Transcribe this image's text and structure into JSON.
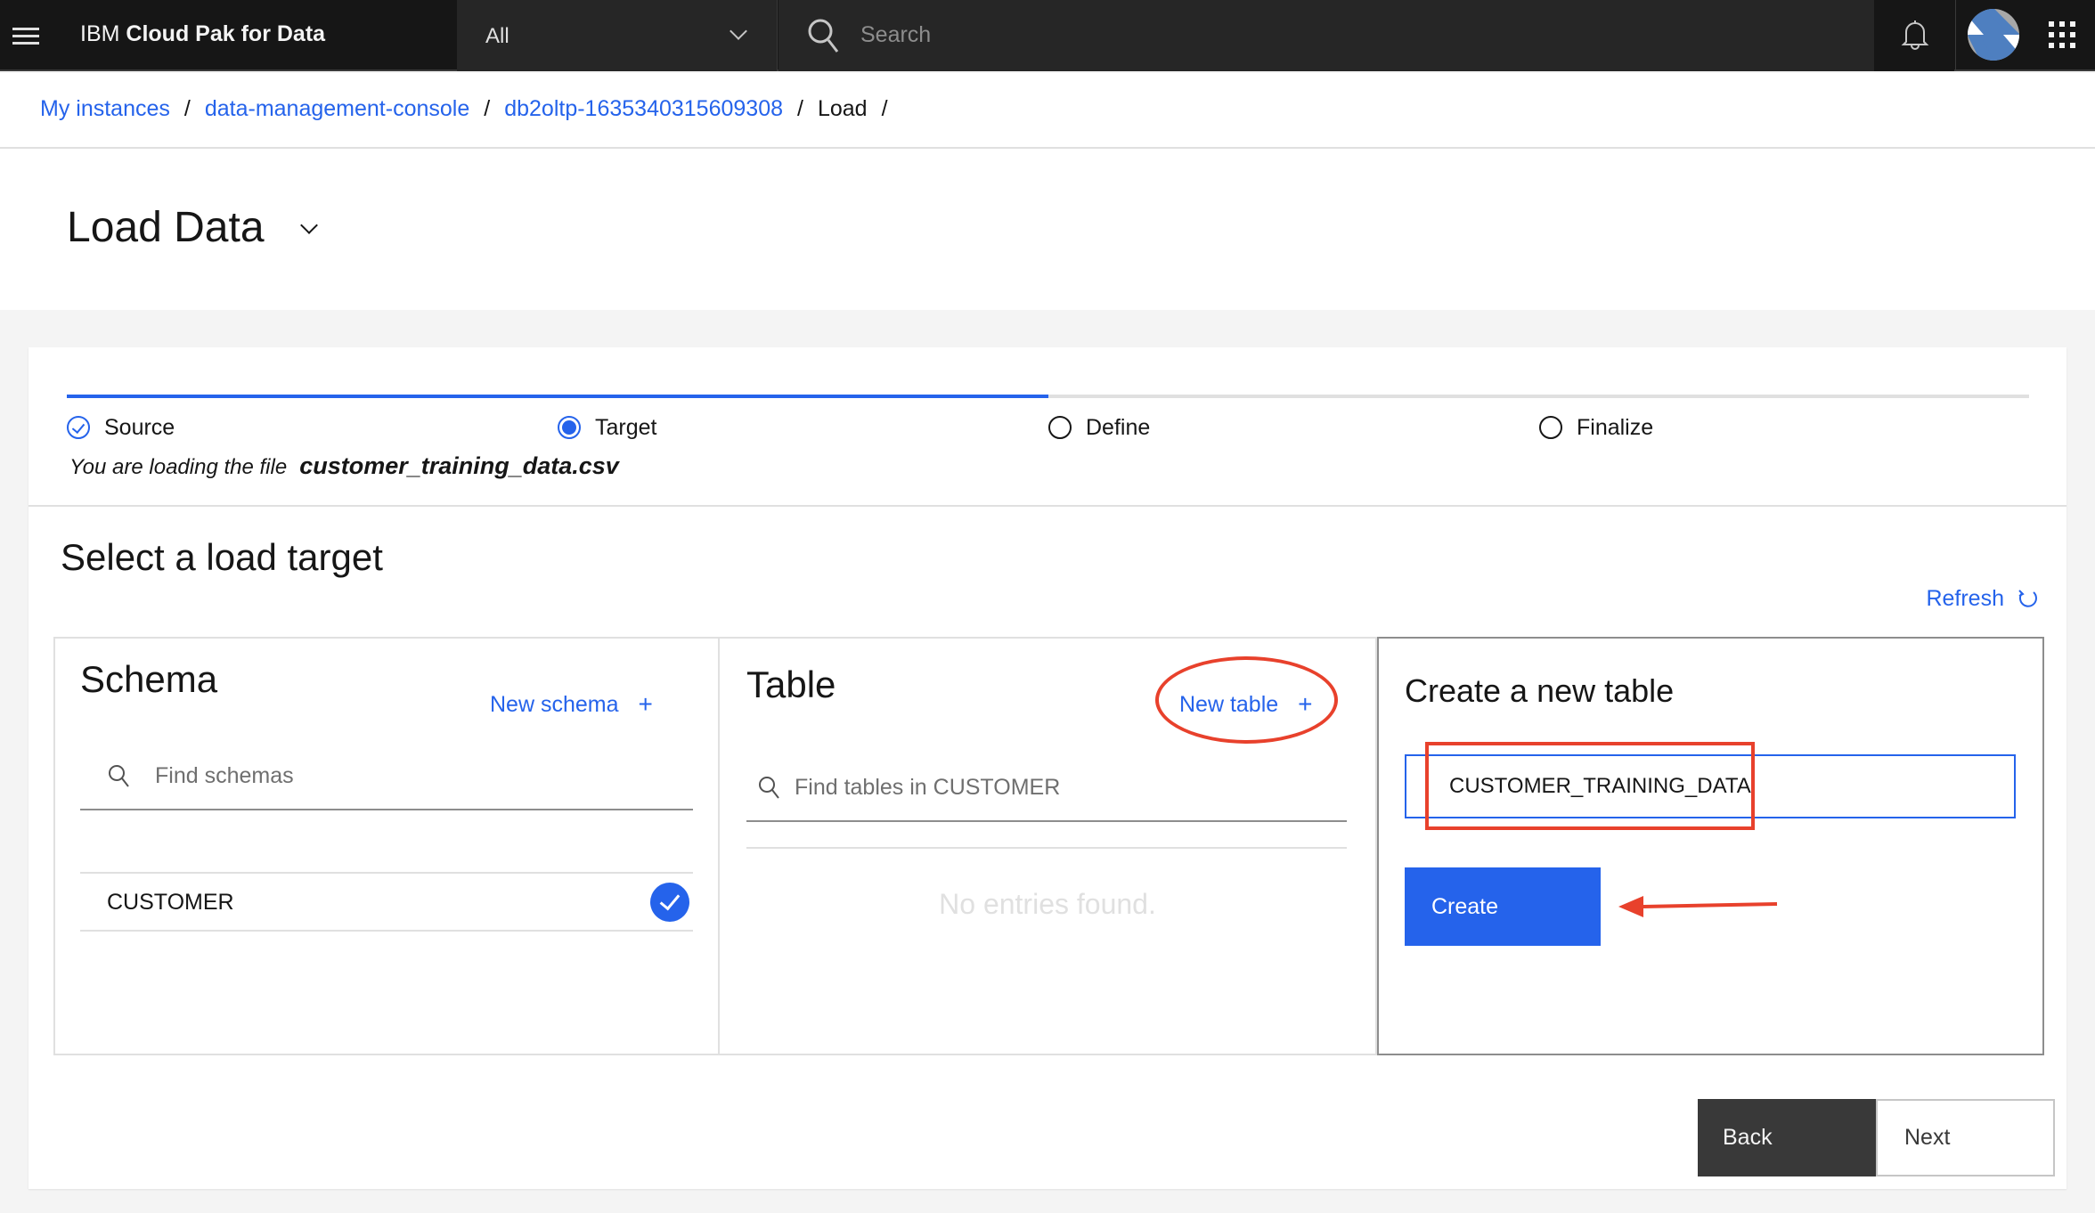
{
  "header": {
    "brand_prefix": "IBM",
    "brand_name": "Cloud Pak for Data",
    "scope_selected": "All",
    "search_placeholder": "Search",
    "icons": [
      "menu-icon",
      "chevron-down-icon",
      "search-icon",
      "notification-bell-icon",
      "user-avatar",
      "app-switcher-icon"
    ]
  },
  "breadcrumb": {
    "items": [
      {
        "label": "My instances",
        "link": true
      },
      {
        "label": "data-management-console",
        "link": true
      },
      {
        "label": "db2oltp-1635340315609308",
        "link": true
      },
      {
        "label": "Load",
        "link": false
      }
    ],
    "separator": "/"
  },
  "page": {
    "title": "Load Data"
  },
  "wizard": {
    "progress_fraction": 0.5,
    "steps": [
      {
        "label": "Source",
        "state": "complete"
      },
      {
        "label": "Target",
        "state": "current"
      },
      {
        "label": "Define",
        "state": "incomplete"
      },
      {
        "label": "Finalize",
        "state": "incomplete"
      }
    ],
    "file_prefix": "You are loading the file",
    "file_name": "customer_training_data.csv"
  },
  "target": {
    "section_title": "Select a load target",
    "refresh_label": "Refresh",
    "schema": {
      "title": "Schema",
      "new_label": "New schema",
      "search_placeholder": "Find schemas",
      "items": [
        {
          "name": "CUSTOMER",
          "selected": true
        }
      ]
    },
    "table": {
      "title": "Table",
      "new_label": "New table",
      "search_placeholder": "Find tables in CUSTOMER",
      "empty_message": "No entries found."
    },
    "create": {
      "title": "Create a new table",
      "input_value": "CUSTOMER_TRAINING_DATA",
      "create_label": "Create"
    }
  },
  "footer": {
    "back_label": "Back",
    "next_label": "Next"
  },
  "colors": {
    "accent": "#2563eb",
    "header_bg": "#161616",
    "annotation": "#e8412c"
  }
}
